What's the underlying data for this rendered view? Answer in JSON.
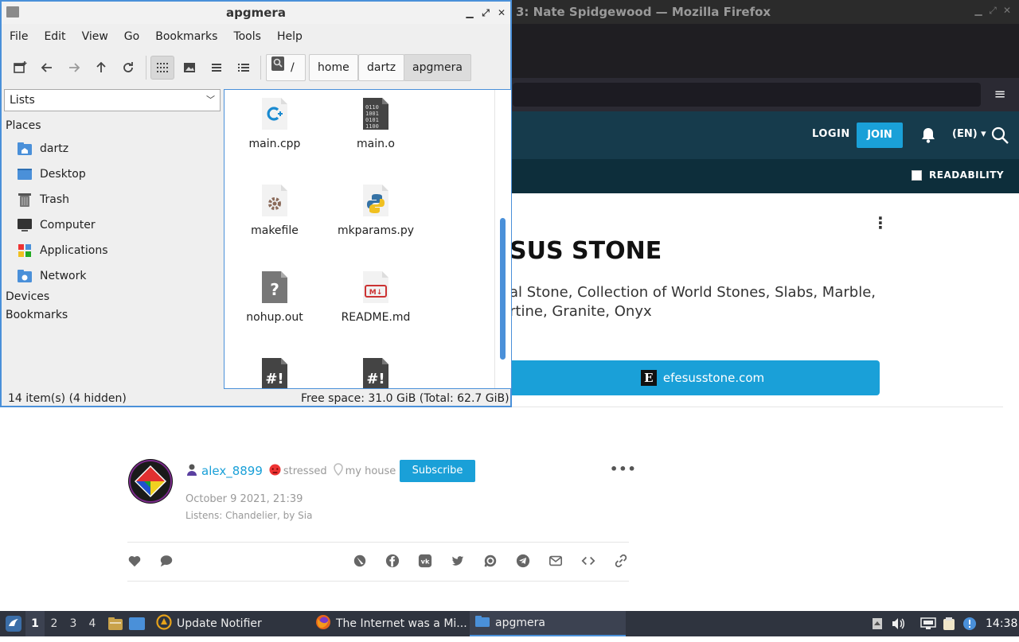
{
  "firefox": {
    "title": "3: Nate Spidgewood — Mozilla Firefox",
    "site": {
      "login": "LOGIN",
      "join": "JOIN",
      "lang": "(EN) ▾",
      "readability": "READABILITY",
      "card_title": "SUS STONE",
      "card_desc": "al Stone, Collection of World Stones, Slabs, Marble, rtine, Granite, Onyx",
      "site_button": "efesusstone.com",
      "site_button_logo": "E"
    },
    "post": {
      "username": "alex_8899",
      "mood": "stressed",
      "location": "my house",
      "subscribe": "Subscribe",
      "date": "October 9 2021, 21:39",
      "listens": "Listens: Chandelier, by Sia",
      "more": "•••"
    }
  },
  "file_manager": {
    "title": "apgmera",
    "menu": [
      "File",
      "Edit",
      "View",
      "Go",
      "Bookmarks",
      "Tools",
      "Help"
    ],
    "breadcrumbs": [
      "/",
      "home",
      "dartz",
      "apgmera"
    ],
    "sidebar_mode": "Lists",
    "places_heading": "Places",
    "places": [
      "dartz",
      "Desktop",
      "Trash",
      "Computer",
      "Applications",
      "Network"
    ],
    "devices_heading": "Devices",
    "bookmarks_heading": "Bookmarks",
    "files": [
      "main.cpp",
      "main.o",
      "makefile",
      "mkparams.py",
      "nohup.out",
      "README.md",
      "",
      ""
    ],
    "status_left": "14 item(s) (4 hidden)",
    "status_right": "Free space: 31.0 GiB (Total: 62.7 GiB)"
  },
  "taskbar": {
    "workspaces": [
      "1",
      "2",
      "3",
      "4"
    ],
    "tasks": [
      "Update Notifier",
      "The Internet was a Mi...",
      "apgmera"
    ],
    "clock": "14:38"
  },
  "colors": {
    "accent": "#1aa0d8",
    "header": "#163b4c",
    "fm_border": "#4a90d9"
  }
}
